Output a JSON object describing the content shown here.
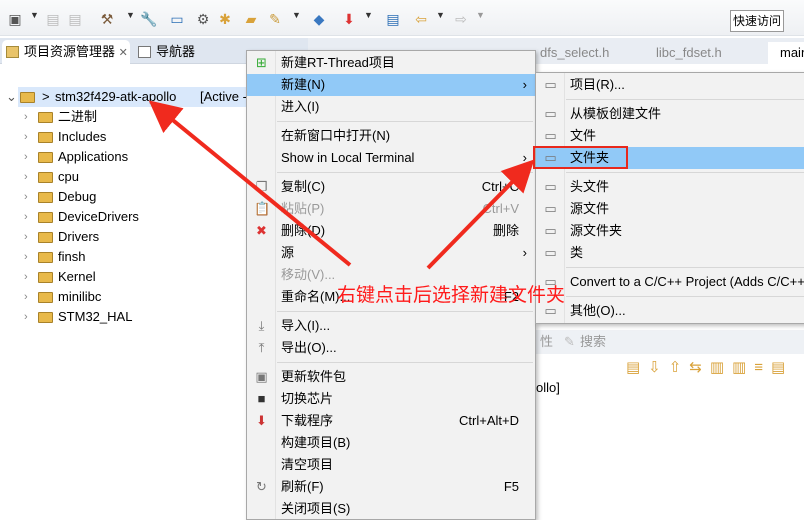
{
  "toolbar": {
    "quick_access": "快速访问"
  },
  "left_panel": {
    "tabs": [
      {
        "label": "项目资源管理器",
        "active": true
      },
      {
        "label": "导航器"
      }
    ],
    "project": {
      "prefix": ">",
      "name": "stm32f429-atk-apollo",
      "status": "[Active -"
    },
    "tree": [
      "二进制",
      "Includes",
      "Applications",
      "cpu",
      "Debug",
      "DeviceDrivers",
      "Drivers",
      "finsh",
      "Kernel",
      "minilibc",
      "STM32_HAL"
    ]
  },
  "editor_tabs": [
    "dfs_select.h",
    "libc_fdset.h",
    "main.c"
  ],
  "context_menu": {
    "items": [
      {
        "label": "新建RT-Thread项目",
        "icon": "new-project-icon"
      },
      {
        "label": "新建(N)",
        "submenu": true,
        "highlighted": true
      },
      {
        "label": "进入(I)"
      },
      {
        "label": "在新窗口中打开(N)"
      },
      {
        "label": "Show in Local Terminal",
        "submenu": true
      },
      {
        "label": "复制(C)",
        "shortcut": "Ctrl+C",
        "icon": "copy-icon"
      },
      {
        "label": "粘贴(P)",
        "shortcut": "Ctrl+V",
        "disabled": true,
        "icon": "paste-icon"
      },
      {
        "label": "删除(D)",
        "shortcut": "删除",
        "icon": "delete-icon"
      },
      {
        "label": "源",
        "submenu": true
      },
      {
        "label": "移动(V)...",
        "disabled": true
      },
      {
        "label": "重命名(M)...",
        "shortcut": "F2"
      },
      {
        "label": "导入(I)...",
        "icon": "import-icon"
      },
      {
        "label": "导出(O)...",
        "icon": "export-icon"
      },
      {
        "label": "更新软件包",
        "icon": "package-icon"
      },
      {
        "label": "切换芯片",
        "icon": "chip-icon"
      },
      {
        "label": "下载程序",
        "shortcut": "Ctrl+Alt+D",
        "icon": "download-icon"
      },
      {
        "label": "构建项目(B)"
      },
      {
        "label": "清空项目"
      },
      {
        "label": "刷新(F)",
        "shortcut": "F5",
        "icon": "refresh-icon"
      },
      {
        "label": "关闭项目(S)"
      }
    ]
  },
  "submenu": {
    "items": [
      {
        "label": "项目(R)..."
      },
      {
        "label": "从模板创建文件"
      },
      {
        "label": "文件"
      },
      {
        "label": "文件夹",
        "highlighted": true
      },
      {
        "label": "头文件"
      },
      {
        "label": "源文件"
      },
      {
        "label": "源文件夹"
      },
      {
        "label": "类"
      },
      {
        "label": "Convert to a C/C++ Project (Adds C/C++"
      },
      {
        "label": "其他(O)..."
      }
    ]
  },
  "background_panel": {
    "tab_partial": "性",
    "search_tab": "搜索",
    "line": "ollo]"
  },
  "annotation": {
    "text": "右键点击后选择新建文件夹",
    "color": "#ff1a1a"
  },
  "colors": {
    "highlight": "#91c9f7",
    "selection": "#d9e8fb",
    "annotation_red": "#e8281c"
  }
}
